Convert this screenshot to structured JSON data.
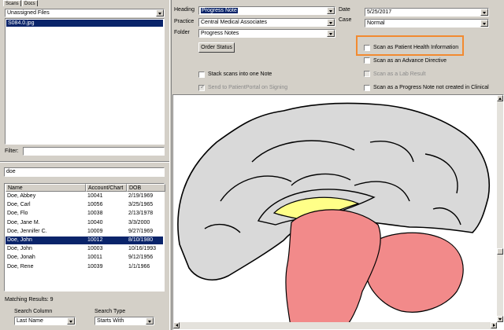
{
  "left_panel": {
    "tabs": [
      "Scans",
      "Docs"
    ],
    "folder_select": "Unassigned Files",
    "files": [
      "S084.0.jpg"
    ],
    "filter_label": "Filter:",
    "filter_value": "",
    "search_value": "doe",
    "patient_table": {
      "columns": [
        "Name",
        "Account/Chart",
        "DOB"
      ],
      "rows": [
        {
          "name": "Doe, Abbey",
          "account": "10041",
          "dob": "2/19/1969"
        },
        {
          "name": "Doe, Carl",
          "account": "10056",
          "dob": "3/25/1965"
        },
        {
          "name": "Doe, Flo",
          "account": "10038",
          "dob": "2/13/1978"
        },
        {
          "name": "Doe, Jane M.",
          "account": "10040",
          "dob": "3/3/2000"
        },
        {
          "name": "Doe, Jennifer C.",
          "account": "10009",
          "dob": "9/27/1969"
        },
        {
          "name": "Doe, John",
          "account": "10012",
          "dob": "8/10/1980"
        },
        {
          "name": "Doe, John",
          "account": "10003",
          "dob": "10/16/1993"
        },
        {
          "name": "Doe, Jonah",
          "account": "10011",
          "dob": "9/12/1956"
        },
        {
          "name": "Doe, Rene",
          "account": "10039",
          "dob": "1/1/1966"
        }
      ],
      "selected_index": 5
    },
    "matching_results": "Matching Results: 9",
    "search_column_label": "Search Column",
    "search_column_value": "Last Name",
    "search_type_label": "Search Type",
    "search_type_value": "Starts With"
  },
  "form": {
    "heading_label": "Heading",
    "heading_value": "Progress Note",
    "practice_label": "Practice",
    "practice_value": "Central Medical Associates",
    "folder_label": "Folder",
    "folder_value": "Progress Notes",
    "order_status_button": "Order Status",
    "date_label": "Date",
    "date_value": "5/25/2017",
    "case_label": "Case",
    "case_value": "Normal",
    "stack_scans": "Stack scans into one Note",
    "send_portal": "Send to PatientPortal on Signing",
    "scan_phi": "Scan as Patient Health Information",
    "scan_advance": "Scan as an Advance Directive",
    "scan_lab": "Scan as a Lab Result",
    "scan_progress": "Scan as a Progress Note not created in Clinical"
  },
  "colors": {
    "highlight_box": "#f28a30",
    "selection": "#0a246a",
    "brain_grey": "#d9d9d9",
    "brainstem": "#f28a8a",
    "corpus": "#ffff88"
  }
}
